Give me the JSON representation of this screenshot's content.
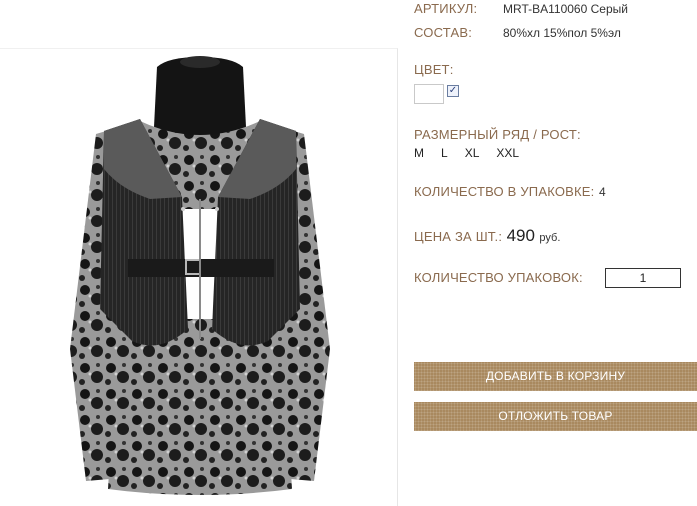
{
  "product": {
    "sku_label": "АРТИКУЛ:",
    "sku_value": "MRT-BA110060 Серый",
    "composition_label": "СОСТАВ:",
    "composition_value": "80%хл 15%пол 5%эл",
    "color_label": "ЦВЕТ:",
    "size_label": "РАЗМЕРНЫЙ РЯД / РОСТ:",
    "sizes": [
      "M",
      "L",
      "XL",
      "XXL"
    ],
    "pack_qty_label": "КОЛИЧЕСТВО В УПАКОВКЕ:",
    "pack_qty_value": "4",
    "price_label": "ЦЕНА ЗА ШТ.:",
    "price_value": "490",
    "price_currency": "руб.",
    "packs_label": "КОЛИЧЕСТВО УПАКОВОК:",
    "packs_value": "1"
  },
  "actions": {
    "add_to_cart": "ДОБАВИТЬ В КОРЗИНУ",
    "postpone": "ОТЛОЖИТЬ ТОВАР"
  },
  "colors": {
    "label": "#8a6a4e",
    "button": "#a9895f"
  },
  "icons": {
    "color_checkbox": "checkbox-checked-icon"
  }
}
